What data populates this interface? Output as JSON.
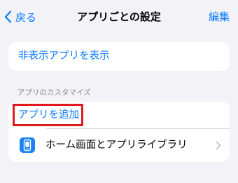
{
  "nav": {
    "back_label": "戻る",
    "title": "アプリごとの設定",
    "edit_label": "編集"
  },
  "show_hidden_apps": {
    "label": "非表示アプリを表示"
  },
  "customize_section": {
    "header": "アプリのカスタマイズ",
    "add_app_label": "アプリを追加",
    "home_screen_item": {
      "label": "ホーム画面とアプリライブラリ",
      "icon": "phone-icon"
    }
  },
  "colors": {
    "accent": "#0a7aff",
    "highlight": "#e0191f",
    "background": "#f2f2f7"
  }
}
